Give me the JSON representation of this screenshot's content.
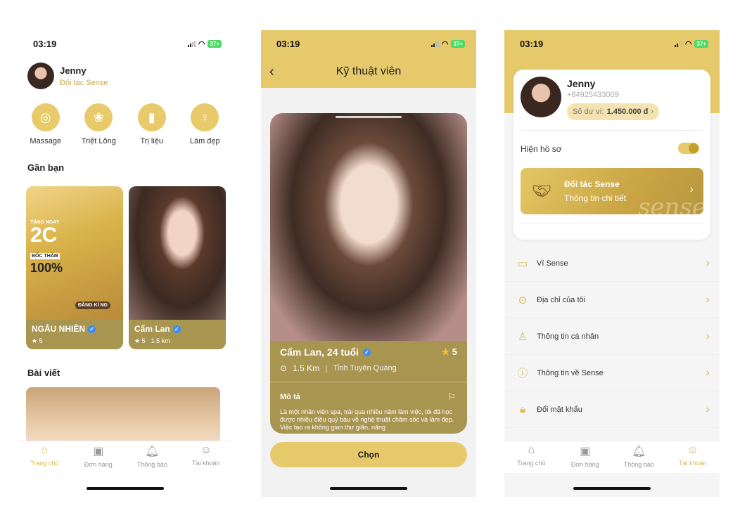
{
  "status": {
    "time": "03:19",
    "battery": "37+"
  },
  "screen1": {
    "user": {
      "name": "Jenny",
      "role": "Đối tác Sense"
    },
    "categories": [
      {
        "label": "Massage",
        "icon": "stones-icon"
      },
      {
        "label": "Triệt Lông",
        "icon": "lotus-icon"
      },
      {
        "label": "Trị liệu",
        "icon": "candle-icon"
      },
      {
        "label": "Làm đẹp",
        "icon": "beauty-icon"
      }
    ],
    "nearby_title": "Gần bạn",
    "cards": [
      {
        "name": "NGẪU NHIÊN",
        "rating": "★ 5",
        "distance": "",
        "promo_line1": "TẶNG NGAY",
        "promo_big": "2C",
        "promo_line2": "BỐC THĂM",
        "promo_pct": "100%",
        "promo_btn": "ĐĂNG KÍ NG"
      },
      {
        "name": "Cẩm Lan",
        "rating": "★ 5",
        "distance": "1.5 km"
      }
    ],
    "posts_title": "Bài viết"
  },
  "tabs": [
    {
      "label": "Trang chủ",
      "icon": "home-icon"
    },
    {
      "label": "Đơn hàng",
      "icon": "orders-icon"
    },
    {
      "label": "Thông báo",
      "icon": "bell-icon"
    },
    {
      "label": "Tài khoản",
      "icon": "account-icon"
    }
  ],
  "screen2": {
    "title": "Kỹ thuật viên",
    "name": "Cẩm Lan, 24 tuổi",
    "rating": "5",
    "distance": "1.5 Km",
    "location": "Tỉnh Tuyên Quang",
    "desc_label": "Mô tả",
    "description": "Là một nhân viên spa, trải qua nhiều năm làm việc, tôi đã học được nhiều điều quý báu về nghệ thuật chăm sóc và làm đẹp. Việc tạo ra không gian thư giãn, năng",
    "button": "Chọn"
  },
  "screen3": {
    "name": "Jenny",
    "phone": "+84925433009",
    "wallet_label": "Số dư ví:",
    "wallet_value": "1.450.000 đ",
    "show_profile": "Hiện hồ sơ",
    "partner_title": "Đối tác Sense",
    "partner_sub": "Thông tin chi tiết",
    "partner_watermark": "sense",
    "menu": [
      {
        "label": "Ví Sense",
        "icon": "wallet-icon"
      },
      {
        "label": "Địa chỉ của tôi",
        "icon": "location-icon"
      },
      {
        "label": "Thông tin cá nhân",
        "icon": "user-icon"
      },
      {
        "label": "Thông tin về Sense",
        "icon": "info-icon"
      },
      {
        "label": "Đổi mật khẩu",
        "icon": "lock-icon"
      }
    ]
  },
  "colors": {
    "accent": "#e6c96b",
    "card": "#a89550",
    "verified": "#3b8cf7"
  }
}
